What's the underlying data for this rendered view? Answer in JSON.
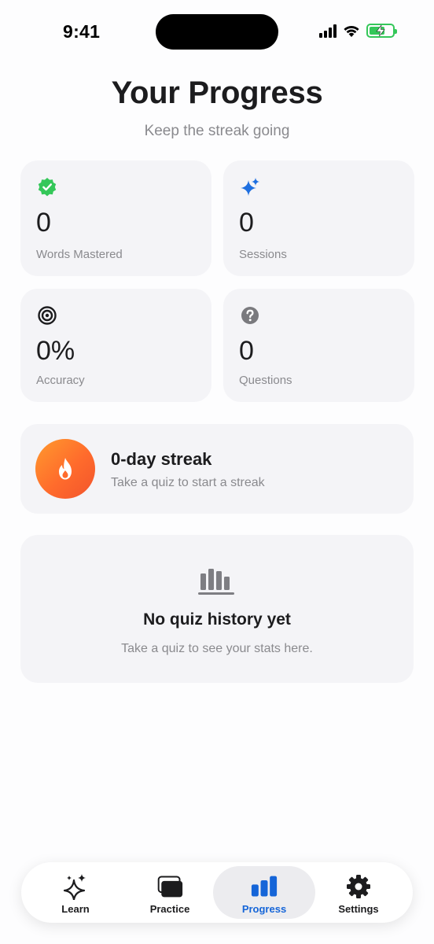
{
  "status_bar": {
    "time": "9:41"
  },
  "header": {
    "title": "Your Progress",
    "subtitle": "Keep the streak going"
  },
  "stats": [
    {
      "value": "0",
      "label": "Words Mastered",
      "icon": "check-badge-icon",
      "color": "#34c759"
    },
    {
      "value": "0",
      "label": "Sessions",
      "icon": "sparkles-icon",
      "color": "#1e6fe0"
    },
    {
      "value": "0%",
      "label": "Accuracy",
      "icon": "target-icon",
      "color": "#1c1c1e"
    },
    {
      "value": "0",
      "label": "Questions",
      "icon": "question-circle-icon",
      "color": "#7a7a7e"
    }
  ],
  "streak": {
    "title": "0-day streak",
    "subtitle": "Take a quiz to start a streak",
    "icon": "flame-icon"
  },
  "history": {
    "title": "No quiz history yet",
    "subtitle": "Take a quiz to see your stats here.",
    "icon": "bar-chart-icon"
  },
  "tabs": [
    {
      "label": "Learn",
      "icon": "sparkles-icon",
      "active": false
    },
    {
      "label": "Practice",
      "icon": "cards-icon",
      "active": false
    },
    {
      "label": "Progress",
      "icon": "bar-chart-icon",
      "active": true
    },
    {
      "label": "Settings",
      "icon": "gear-icon",
      "active": false
    }
  ],
  "colors": {
    "accent": "#1565d8",
    "card_bg": "#f4f4f7",
    "streak_gradient_start": "#ff9a2e",
    "streak_gradient_end": "#f2542d"
  }
}
